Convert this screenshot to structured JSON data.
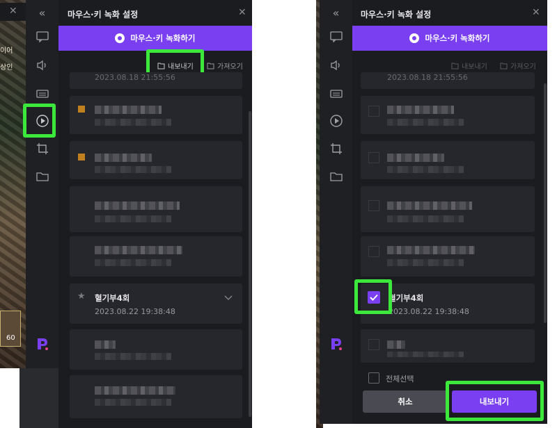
{
  "left": {
    "game": {
      "label_partial_1": "이어",
      "label_partial_2": "상인",
      "number": "60"
    },
    "panel": {
      "title": "마우스·키 녹화 설정",
      "record_button": "마우스·키 녹화하기",
      "export_label": "내보내기",
      "import_label": "가져오기",
      "partial_time": "2023.08.18 21:55:56",
      "featured": {
        "name": "혈기부4회",
        "time": "2023.08.22 19:38:48"
      }
    }
  },
  "right": {
    "panel": {
      "title": "마우스·키 녹화 설정",
      "record_button": "마우스·키 녹화하기",
      "export_label": "내보내기",
      "import_label": "가져오기",
      "partial_time": "2023.08.18 21:55:56",
      "featured": {
        "name": "혈기부4회",
        "time": "2023.08.22 19:38:48"
      },
      "select_all": "전체선택",
      "cancel_button": "취소",
      "export_button": "내보내기"
    }
  },
  "icons": [
    "close-icon",
    "double-chevron-left-icon",
    "chat-icon",
    "speaker-icon",
    "keyboard-icon",
    "macro-record-icon",
    "crop-icon",
    "folder-icon",
    "app-logo-icon",
    "export-icon",
    "import-icon",
    "star-icon",
    "chevron-down-icon",
    "checkbox-checked-icon"
  ],
  "colors": {
    "accent": "#7a3ff0",
    "highlight": "#3be83b",
    "panel": "#1b1c20",
    "rail": "#1f2024"
  }
}
